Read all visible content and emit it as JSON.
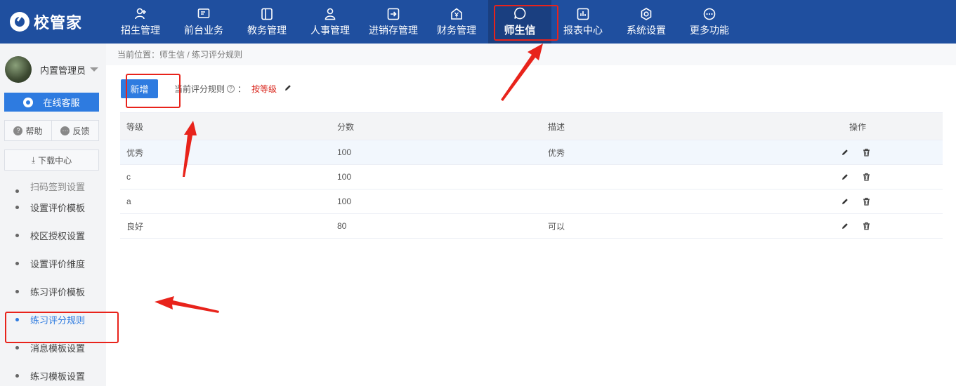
{
  "brand": {
    "name": "校管家"
  },
  "nav": [
    {
      "label": "招生管理",
      "icon": "user-add-icon"
    },
    {
      "label": "前台业务",
      "icon": "monitor-icon"
    },
    {
      "label": "教务管理",
      "icon": "book-icon"
    },
    {
      "label": "人事管理",
      "icon": "person-icon"
    },
    {
      "label": "进销存管理",
      "icon": "inbox-arrow-icon"
    },
    {
      "label": "财务管理",
      "icon": "yen-house-icon"
    },
    {
      "label": "师生信",
      "icon": "chat-bubble-icon",
      "active": true
    },
    {
      "label": "报表中心",
      "icon": "bar-chart-icon"
    },
    {
      "label": "系统设置",
      "icon": "gear-icon"
    },
    {
      "label": "更多功能",
      "icon": "more-icon"
    }
  ],
  "sidebar": {
    "user_name": "内置管理员",
    "service_label": "在线客服",
    "help_label": "帮助",
    "feedback_label": "反馈",
    "download_label": "下载中心",
    "cut_item": "扫码签到设置",
    "items": [
      {
        "label": "设置评价模板"
      },
      {
        "label": "校区授权设置"
      },
      {
        "label": "设置评价维度"
      },
      {
        "label": "练习评价模板"
      },
      {
        "label": "练习评分规则",
        "active": true
      },
      {
        "label": "消息模板设置"
      },
      {
        "label": "练习模板设置"
      }
    ]
  },
  "breadcrumb": "当前位置：师生信 / 练习评分规则",
  "toolbar": {
    "new_label": "新增",
    "rule_label": "当前评分规则",
    "rule_colon": "：",
    "rule_value": "按等级"
  },
  "table": {
    "headers": [
      "等级",
      "分数",
      "描述",
      "操作"
    ],
    "rows": [
      {
        "level": "优秀",
        "score": "100",
        "desc": "优秀"
      },
      {
        "level": "c",
        "score": "100",
        "desc": ""
      },
      {
        "level": "a",
        "score": "100",
        "desc": ""
      },
      {
        "level": "良好",
        "score": "80",
        "desc": "可以"
      }
    ]
  },
  "colors": {
    "nav_bg": "#1f4f9f",
    "accent": "#2e7be0",
    "rule_value": "#d9261c",
    "annotation": "#e8231b"
  }
}
